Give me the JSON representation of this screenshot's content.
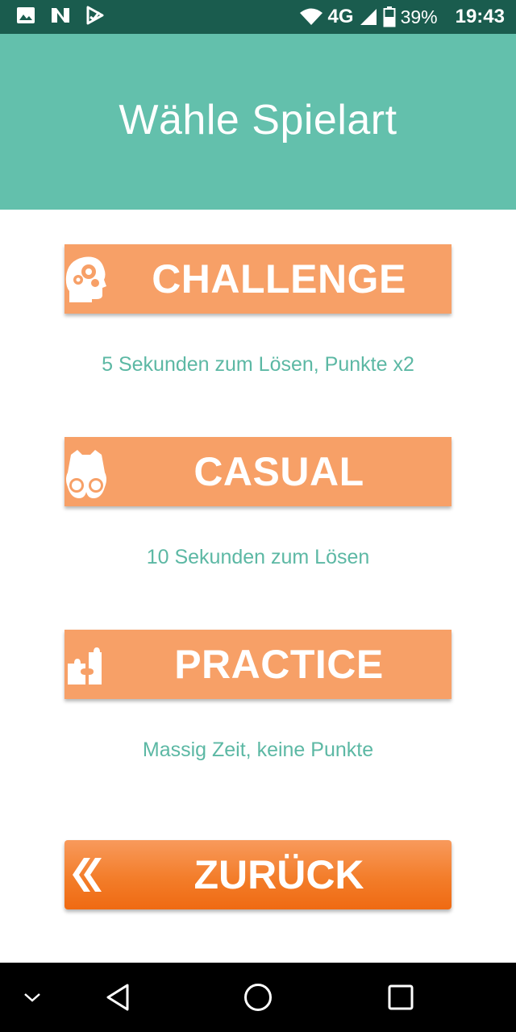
{
  "status_bar": {
    "icons": [
      "image-icon",
      "n-notification-icon",
      "play-store-icon",
      "wifi-icon",
      "signal-icon",
      "battery-icon"
    ],
    "network": "4G",
    "battery": "39%",
    "time": "19:43"
  },
  "header": {
    "title": "Wähle Spielart"
  },
  "modes": [
    {
      "label": "CHALLENGE",
      "icon": "head-gears-icon",
      "description": "5 Sekunden zum Lösen, Punkte x2"
    },
    {
      "label": "CASUAL",
      "icon": "binoculars-icon",
      "description": "10 Sekunden zum Lösen"
    },
    {
      "label": "PRACTICE",
      "icon": "puzzle-icon",
      "description": "Massig Zeit, keine Punkte"
    }
  ],
  "back": {
    "label": "ZURÜCK",
    "icon": "double-chevron-left-icon"
  },
  "nav_bar": {
    "icons": [
      "chevron-down-icon",
      "back-triangle-icon",
      "home-circle-icon",
      "recents-square-icon"
    ]
  },
  "colors": {
    "status_bar": "#1a5c4e",
    "header": "#63c0ac",
    "mode_button": "#f7a067",
    "description_text": "#5cb8a4",
    "back_button": "#f37d2a"
  }
}
